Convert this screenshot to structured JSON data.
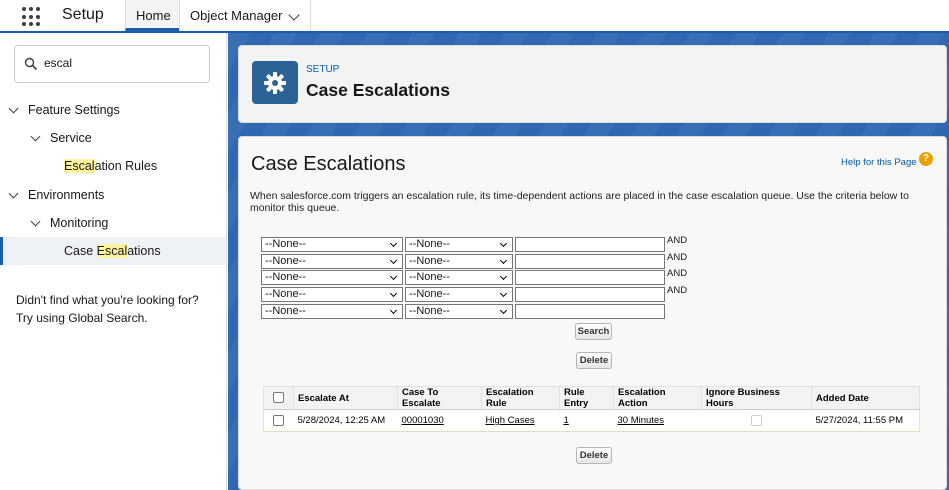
{
  "topnav": {
    "app_name": "Setup",
    "tabs": [
      {
        "label": "Home"
      },
      {
        "label": "Object Manager"
      }
    ]
  },
  "sidebar": {
    "search_value": "escal",
    "tree": [
      {
        "pre": "",
        "match": "",
        "post": "Feature Settings"
      },
      {
        "pre": "",
        "match": "",
        "post": "Service"
      },
      {
        "pre": "",
        "match": "Escal",
        "post": "ation Rules"
      },
      {
        "pre": "",
        "match": "",
        "post": "Environments"
      },
      {
        "pre": "",
        "match": "",
        "post": "Monitoring"
      },
      {
        "pre": "Case ",
        "match": "Escal",
        "post": "ations"
      }
    ],
    "not_found_line1": "Didn't find what you're looking for?",
    "not_found_line2": "Try using Global Search."
  },
  "header": {
    "eyebrow": "SETUP",
    "title": "Case Escalations"
  },
  "content": {
    "title": "Case Escalations",
    "help_link": "Help for this Page",
    "help_icon": "?",
    "description": "When salesforce.com triggers an escalation rule, its time-dependent actions are placed in the case escalation queue. Use the criteria below to monitor this queue.",
    "criteria": [
      {
        "field": "--None--",
        "operator": "--None--",
        "connector": "AND"
      },
      {
        "field": "--None--",
        "operator": "--None--",
        "connector": "AND"
      },
      {
        "field": "--None--",
        "operator": "--None--",
        "connector": "AND"
      },
      {
        "field": "--None--",
        "operator": "--None--",
        "connector": "AND"
      },
      {
        "field": "--None--",
        "operator": "--None--",
        "connector": ""
      }
    ],
    "search_button": "Search",
    "delete_button": "Delete",
    "table": {
      "headers": [
        "Escalate At",
        "Case To Escalate",
        "Escalation Rule",
        "Rule Entry",
        "Escalation Action",
        "Ignore Business Hours",
        "Added Date"
      ],
      "rows": [
        {
          "escalate_at": "5/28/2024, 12:25 AM",
          "case": "00001030",
          "rule": "High Cases",
          "entry": "1",
          "action": "30 Minutes",
          "added": "5/27/2024, 11:55 PM"
        }
      ]
    },
    "bottom_delete_button": "Delete"
  }
}
